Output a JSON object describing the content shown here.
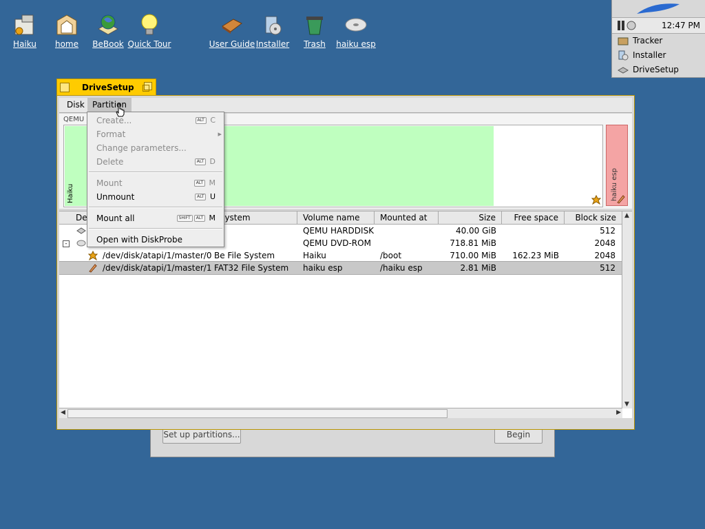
{
  "desktop": {
    "icons": [
      {
        "label": "Haiku",
        "icon": "haiku-disk-icon"
      },
      {
        "label": "home",
        "icon": "home-folder-icon"
      },
      {
        "label": "BeBook",
        "icon": "bebook-icon"
      },
      {
        "label": "Quick Tour",
        "icon": "lightbulb-icon"
      },
      {
        "label": "User Guide",
        "icon": "book-icon"
      },
      {
        "label": "Installer",
        "icon": "installer-icon"
      },
      {
        "label": "Trash",
        "icon": "trash-icon"
      },
      {
        "label": "haiku esp",
        "icon": "cd-disk-icon"
      }
    ]
  },
  "deskbar": {
    "clock": "12:47 PM",
    "apps": [
      {
        "label": "Tracker",
        "icon": "tracker-icon"
      },
      {
        "label": "Installer",
        "icon": "installer-icon"
      },
      {
        "label": "DriveSetup",
        "icon": "drivesetup-icon"
      }
    ]
  },
  "background_window": {
    "setup_button": "Set up partitions...",
    "begin_button": "Begin"
  },
  "window": {
    "title": "DriveSetup",
    "menus": {
      "disk": "Disk",
      "partition": "Partition"
    },
    "diskmap": {
      "disk_label": "QEMU",
      "partition1_label": "Haiku",
      "partition2_label": "haiku esp"
    },
    "table": {
      "headers": {
        "device": "Dev",
        "filesystem": "e system",
        "volume": "Volume name",
        "mounted": "Mounted at",
        "size": "Size",
        "free": "Free space",
        "block": "Block size"
      },
      "rows": [
        {
          "device": "",
          "filesystem": "",
          "volume": "QEMU HARDDISK",
          "mounted": "",
          "size": "40.00 GiB",
          "free": "",
          "block": "512"
        },
        {
          "device": "",
          "filesystem": "",
          "volume": "QEMU DVD-ROM",
          "mounted": "",
          "size": "718.81 MiB",
          "free": "",
          "block": "2048"
        },
        {
          "device": "/dev/disk/atapi/1/master/0",
          "filesystem": "Be File System",
          "volume": "Haiku",
          "mounted": "/boot",
          "size": "710.00 MiB",
          "free": "162.23 MiB",
          "block": "2048"
        },
        {
          "device": "/dev/disk/atapi/1/master/1",
          "filesystem": "FAT32 File System",
          "volume": "haiku esp",
          "mounted": "/haiku esp",
          "size": "2.81 MiB",
          "free": "",
          "block": "512"
        }
      ]
    }
  },
  "partition_menu": {
    "items": [
      {
        "label": "Create...",
        "shortcut": "C"
      },
      {
        "label": "Format"
      },
      {
        "label": "Change parameters..."
      },
      {
        "label": "Delete",
        "shortcut": "D"
      },
      {
        "label": "Mount",
        "shortcut": "M"
      },
      {
        "label": "Unmount",
        "shortcut": "U"
      },
      {
        "label": "Mount all",
        "shortcut": "M"
      },
      {
        "label": "Open with DiskProbe"
      }
    ],
    "key_alt": "ALT",
    "key_shift": "SHIFT"
  }
}
